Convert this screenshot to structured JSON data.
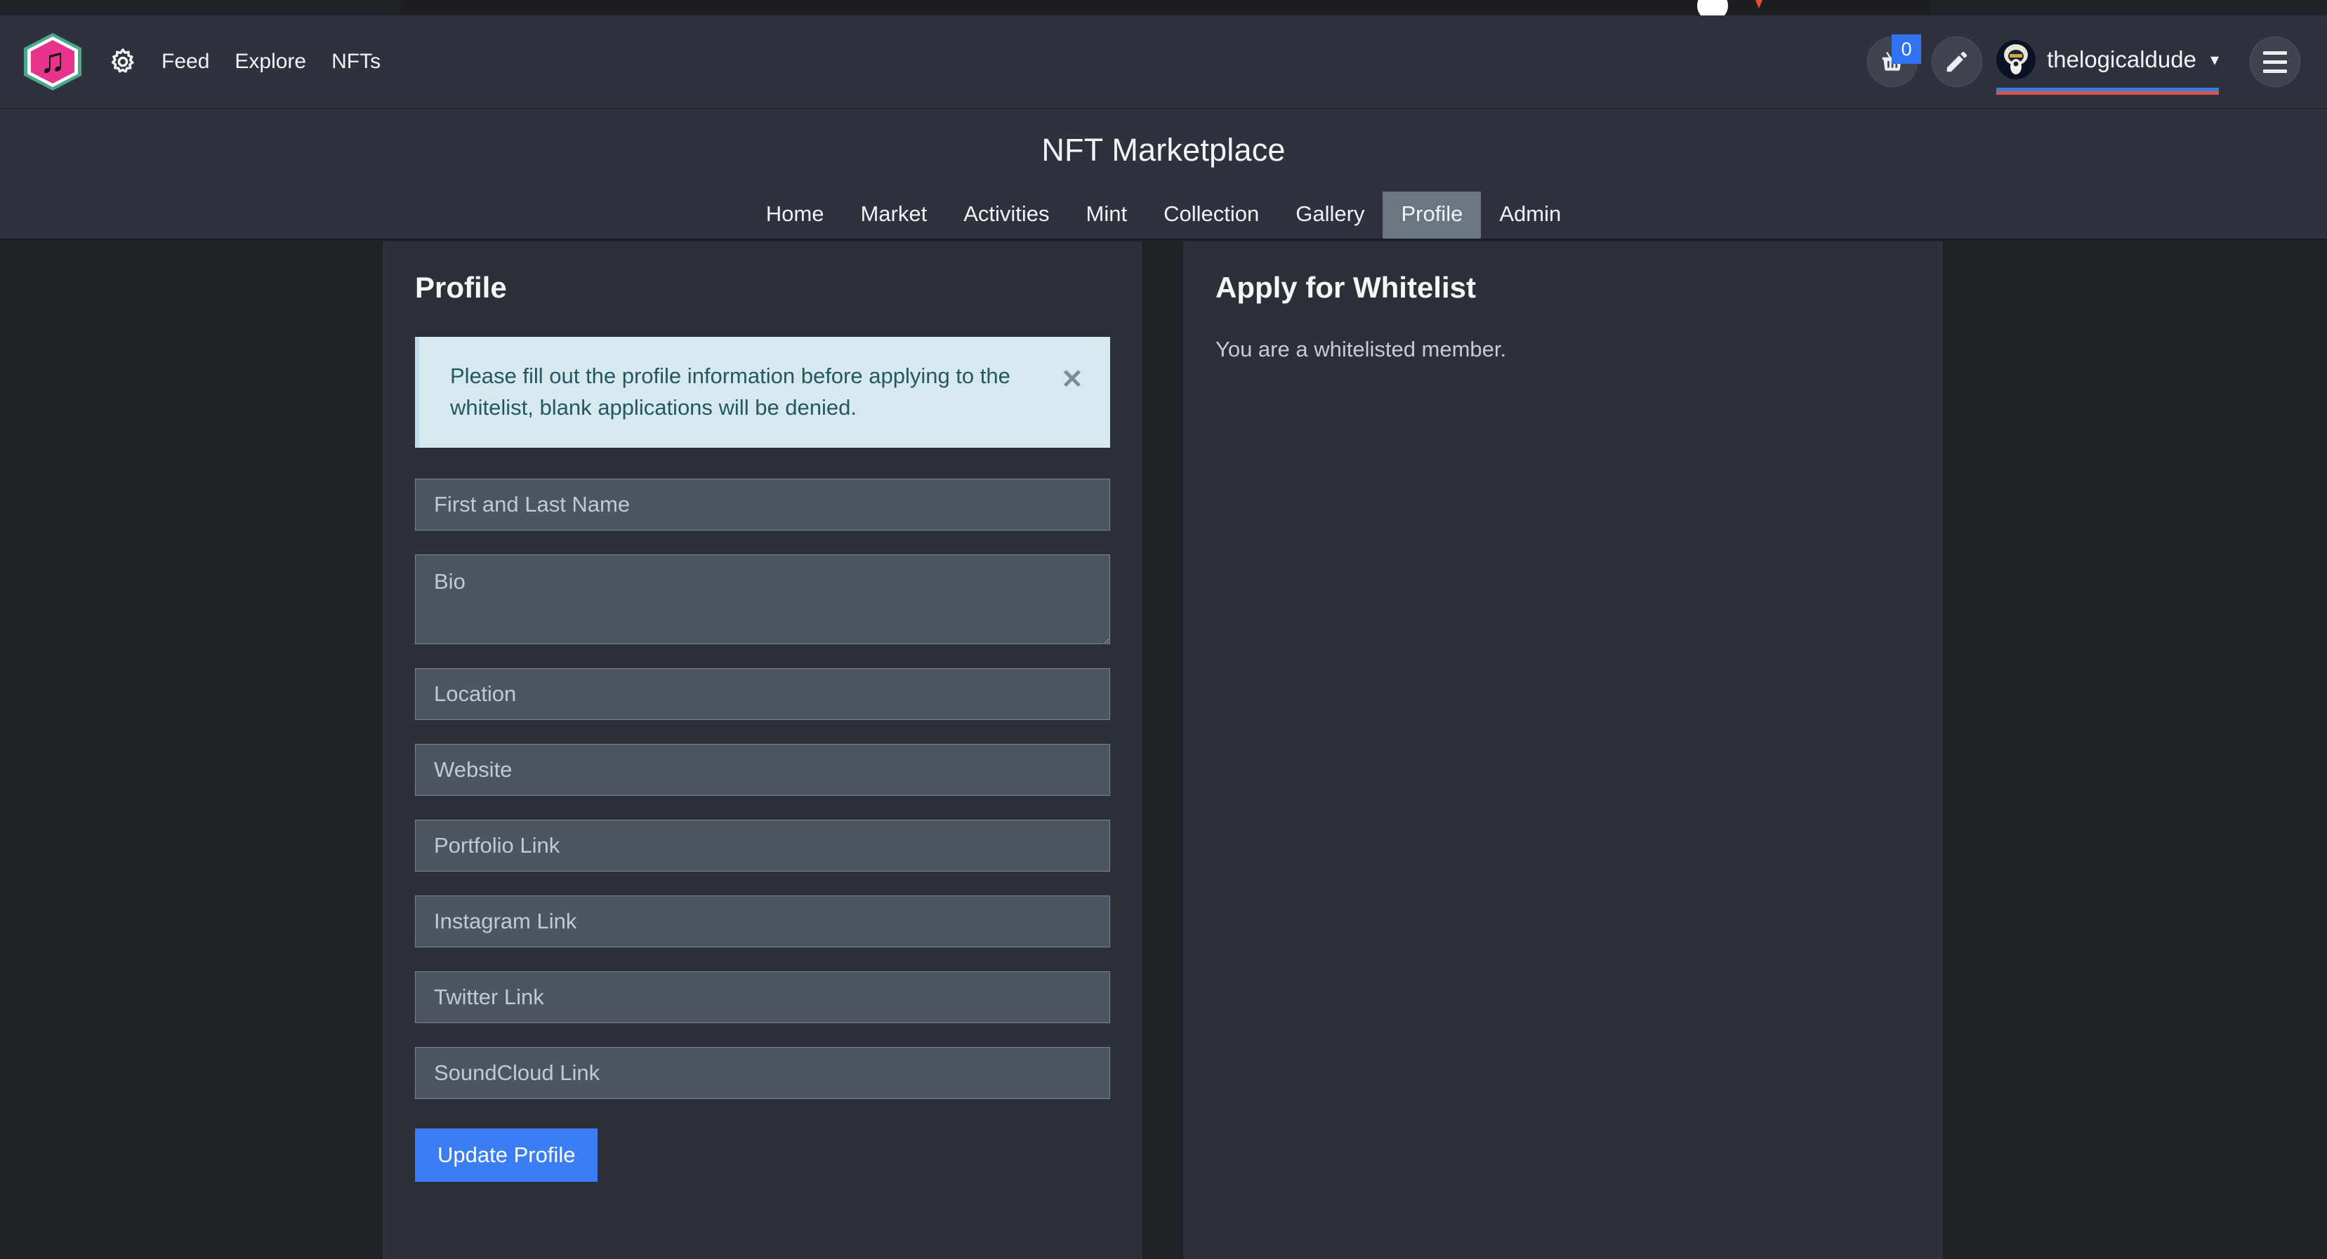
{
  "browser": {
    "chrome_visible": true
  },
  "topbar": {
    "logo": {
      "icon": "music-note-hexagon-logo",
      "glyph": "♫",
      "colors": {
        "ring": "#4aa88c",
        "fill": "#e8328c",
        "note": "#111111"
      }
    },
    "gear_icon": "gear-icon",
    "links": [
      {
        "label": "Feed"
      },
      {
        "label": "Explore"
      },
      {
        "label": "NFTs"
      }
    ],
    "cart": {
      "icon": "shopping-basket-icon",
      "badge_count": "0",
      "badge_color": "#2f73f4"
    },
    "edit": {
      "icon": "pencil-edit-icon"
    },
    "user": {
      "avatar_icon": "user-avatar",
      "name": "thelogicaldude",
      "caret_icon": "chevron-down-icon",
      "underline_colors": {
        "top": "#3b7ddd",
        "bottom": "#d9534f"
      }
    },
    "menu": {
      "icon": "hamburger-menu-icon"
    }
  },
  "subheader": {
    "title": "NFT Marketplace",
    "tabs": [
      {
        "label": "Home",
        "active": false
      },
      {
        "label": "Market",
        "active": false
      },
      {
        "label": "Activities",
        "active": false
      },
      {
        "label": "Mint",
        "active": false
      },
      {
        "label": "Collection",
        "active": false
      },
      {
        "label": "Gallery",
        "active": false
      },
      {
        "label": "Profile",
        "active": true
      },
      {
        "label": "Admin",
        "active": false
      }
    ],
    "active_tab": "Profile"
  },
  "profile_card": {
    "title": "Profile",
    "alert": {
      "message": "Please fill out the profile information before applying to the whitelist, blank applications will be denied.",
      "close_icon": "close-x-icon",
      "background": "#d6e9ef",
      "text_color": "#255662"
    },
    "fields": [
      {
        "name": "full-name",
        "placeholder": "First and Last Name",
        "value": "",
        "type": "text"
      },
      {
        "name": "bio",
        "placeholder": "Bio",
        "value": "",
        "type": "textarea"
      },
      {
        "name": "location",
        "placeholder": "Location",
        "value": "",
        "type": "text"
      },
      {
        "name": "website",
        "placeholder": "Website",
        "value": "",
        "type": "text"
      },
      {
        "name": "portfolio-link",
        "placeholder": "Portfolio Link",
        "value": "",
        "type": "text"
      },
      {
        "name": "instagram-link",
        "placeholder": "Instagram Link",
        "value": "",
        "type": "text"
      },
      {
        "name": "twitter-link",
        "placeholder": "Twitter Link",
        "value": "",
        "type": "text"
      },
      {
        "name": "soundcloud-link",
        "placeholder": "SoundCloud Link",
        "value": "",
        "type": "text"
      }
    ],
    "submit_label": "Update Profile",
    "submit_color": "#3b7ef4"
  },
  "whitelist_card": {
    "title": "Apply for Whitelist",
    "status": "You are a whitelisted member."
  },
  "theme": {
    "page_background": "#1f2227",
    "header_background": "#2e323c",
    "card_background": "#2c3038",
    "input_background": "#4d5462",
    "active_tab_background": "#6c7582",
    "accent": "#3b7ef4"
  }
}
